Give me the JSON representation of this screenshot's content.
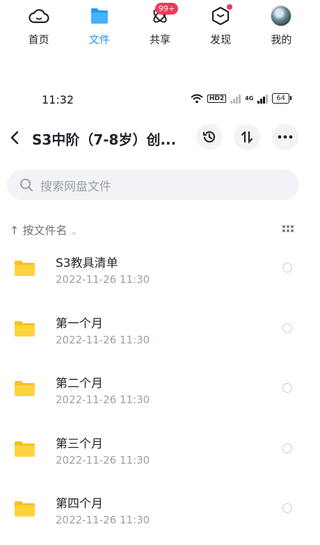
{
  "topnav": {
    "tabs": [
      {
        "label": "首页",
        "icon": "cloud-icon",
        "active": false
      },
      {
        "label": "文件",
        "icon": "folder-icon",
        "active": true
      },
      {
        "label": "共享",
        "icon": "atom-icon",
        "active": false,
        "badge": "99+"
      },
      {
        "label": "发现",
        "icon": "cube-icon",
        "active": false,
        "dot": true
      },
      {
        "label": "我的",
        "icon": "avatar",
        "active": false
      }
    ],
    "accent": "#1e9bf0",
    "badge_color": "#f2395b"
  },
  "status_bar": {
    "time": "11:32",
    "hd_label": "HD2",
    "network_label": "4G",
    "battery": "64"
  },
  "header": {
    "title": "S3中阶（7-8岁）创...",
    "icons": [
      "back-arrow-icon",
      "history-icon",
      "sort-icon",
      "more-icon"
    ]
  },
  "search": {
    "placeholder": "搜索网盘文件"
  },
  "sort": {
    "label": "按文件名"
  },
  "files": [
    {
      "name": "S3教具清单",
      "date": "2022-11-26  11:30"
    },
    {
      "name": "第一个月",
      "date": "2022-11-26  11:30"
    },
    {
      "name": "第二个月",
      "date": "2022-11-26  11:30"
    },
    {
      "name": "第三个月",
      "date": "2022-11-26  11:30"
    },
    {
      "name": "第四个月",
      "date": "2022-11-26  11:30"
    }
  ],
  "colors": {
    "folder": "#ffd33d",
    "folder_tab": "#f5c21e"
  }
}
